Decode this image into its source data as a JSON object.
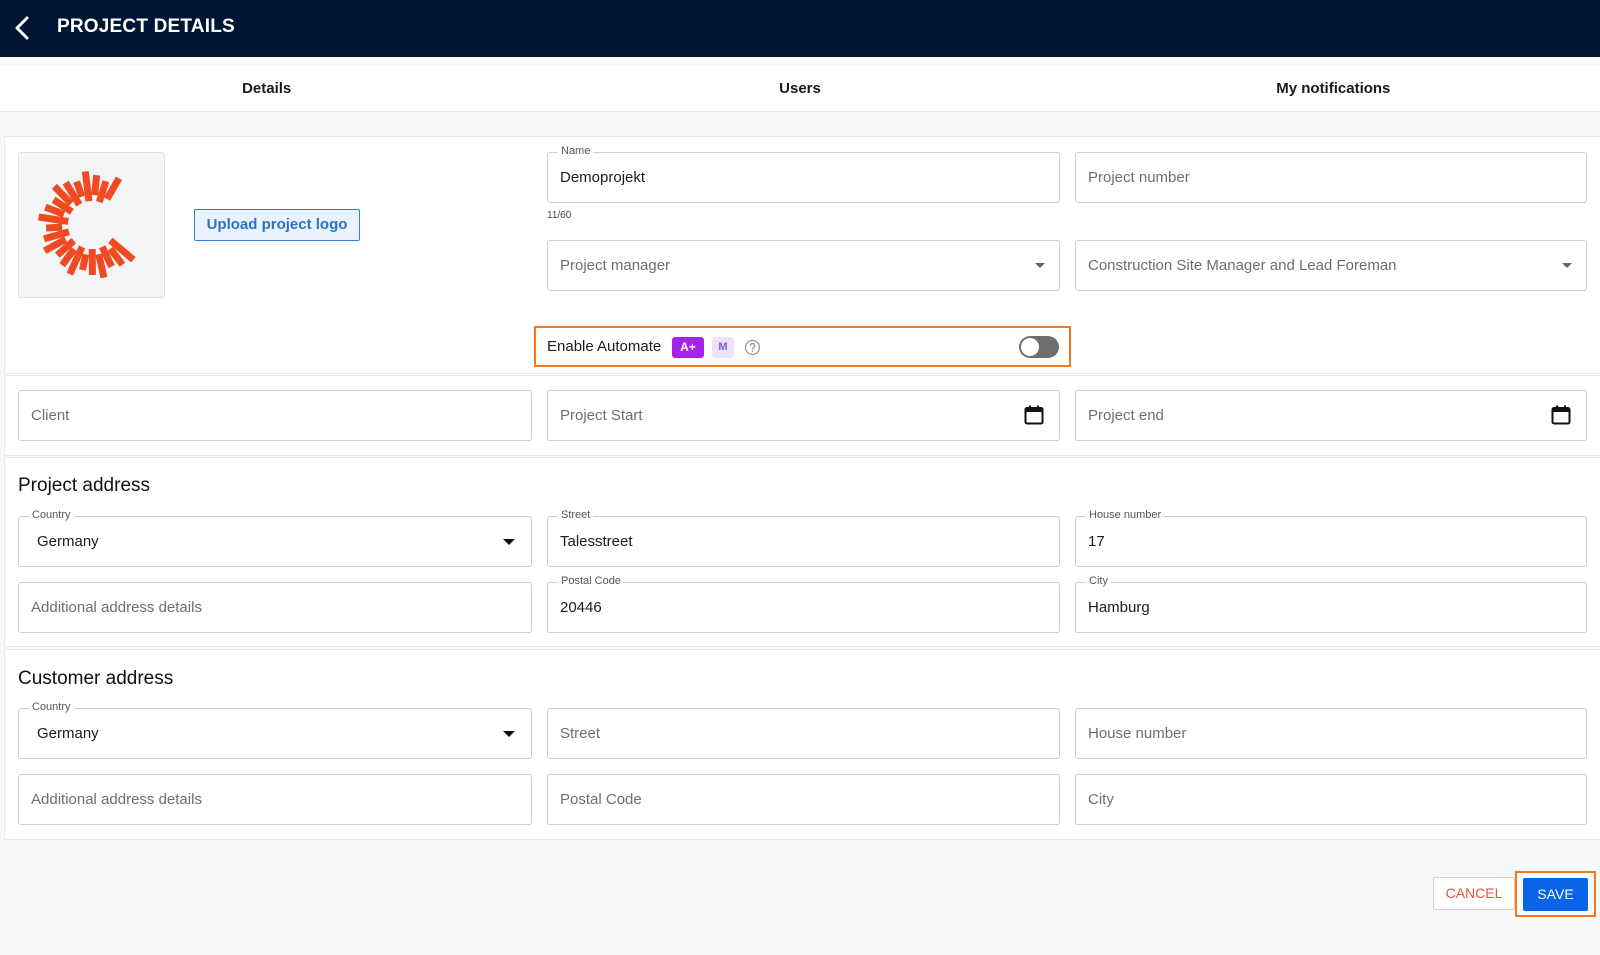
{
  "header": {
    "title": "PROJECT DETAILS"
  },
  "tabs": [
    {
      "label": "Details"
    },
    {
      "label": "Users"
    },
    {
      "label": "My notifications"
    }
  ],
  "logo": {
    "upload_label": "Upload project logo",
    "brand_color": "#f04a23"
  },
  "project": {
    "name_label": "Name",
    "name_value": "Demoprojekt",
    "name_counter": "11/60",
    "number_placeholder": "Project number",
    "manager_placeholder": "Project manager",
    "role_value": "Construction Site Manager and Lead Foreman"
  },
  "automate": {
    "label": "Enable Automate",
    "badge_a": "A+",
    "badge_m": "M",
    "enabled": false,
    "highlight_color": "#f07a1c"
  },
  "dates": {
    "client_placeholder": "Client",
    "start_placeholder": "Project Start",
    "end_placeholder": "Project end"
  },
  "project_address": {
    "title": "Project address",
    "country_label": "Country",
    "country_value": "Germany",
    "street_label": "Street",
    "street_value": "Talesstreet",
    "house_label": "House number",
    "house_value": "17",
    "additional_placeholder": "Additional address details",
    "postal_label": "Postal Code",
    "postal_value": "20446",
    "city_label": "City",
    "city_value": "Hamburg"
  },
  "customer_address": {
    "title": "Customer address",
    "country_label": "Country",
    "country_value": "Germany",
    "street_placeholder": "Street",
    "house_placeholder": "House number",
    "additional_placeholder": "Additional address details",
    "postal_placeholder": "Postal Code",
    "city_placeholder": "City"
  },
  "footer": {
    "cancel_label": "CANCEL",
    "save_label": "SAVE",
    "save_color": "#0a64e8"
  }
}
